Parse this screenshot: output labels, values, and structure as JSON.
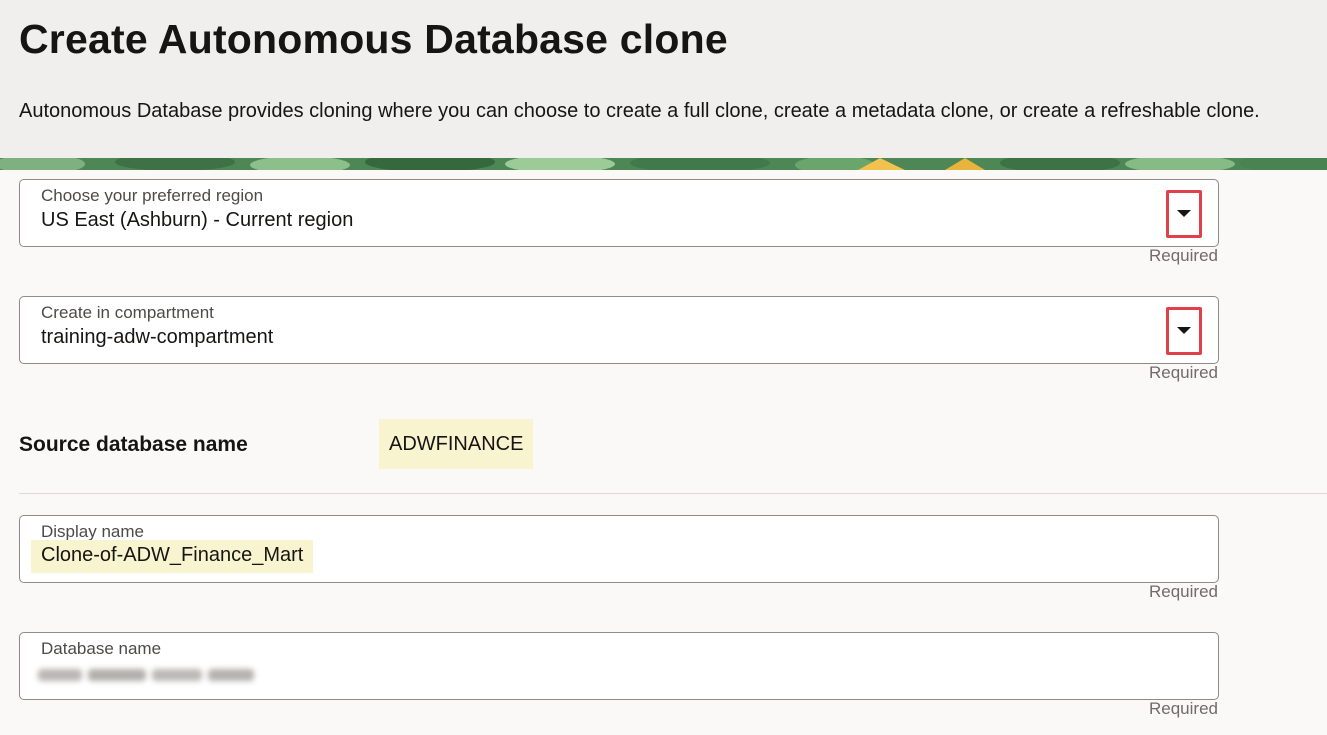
{
  "page": {
    "title": "Create Autonomous Database clone",
    "description": "Autonomous Database provides cloning where you can choose to create a full clone, create a metadata clone, or create a refreshable clone."
  },
  "form": {
    "region": {
      "label": "Choose your preferred region",
      "value": "US East (Ashburn) - Current region",
      "required": "Required"
    },
    "compartment": {
      "label": "Create in compartment",
      "value": "training-adw-compartment",
      "required": "Required"
    },
    "source": {
      "label": "Source database name",
      "value": "ADWFINANCE"
    },
    "display_name": {
      "label": "Display name",
      "value": "Clone-of-ADW_Finance_Mart",
      "required": "Required"
    },
    "database_name": {
      "label": "Database name",
      "required": "Required"
    }
  },
  "icons": {
    "dropdown": "caret-down-icon"
  },
  "colors": {
    "highlight_box": "#e0404a",
    "value_highlight": "#f8f4cf",
    "header_bg": "#f1efed"
  }
}
